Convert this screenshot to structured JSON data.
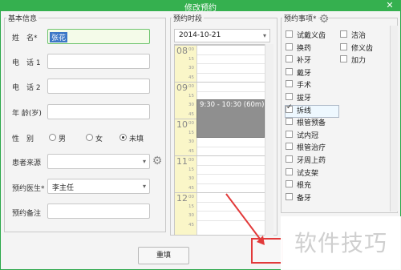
{
  "window": {
    "title": "修改预约",
    "close_label": "✕"
  },
  "basic_info": {
    "legend": "基本信息",
    "name_label": "姓　名*",
    "name_value": "张花",
    "phone1_label": "电　话 1",
    "phone2_label": "电　话 2",
    "age_label": "年 龄(岁)",
    "gender_label": "性　别",
    "gender_options": [
      "男",
      "女",
      "未填"
    ],
    "gender_selected": "未填",
    "source_label": "患者来源",
    "source_value": "",
    "doctor_label": "预约医生*",
    "doctor_value": "李主任",
    "note_label": "预约备注"
  },
  "time_slot": {
    "legend": "预约时段",
    "date_value": "2014-10-21",
    "hours": [
      "08",
      "09",
      "10",
      "11",
      "12"
    ],
    "minute_labels": [
      "00",
      "15",
      "30",
      "45"
    ],
    "appointment_label": "9:30 - 10:30 (60m)"
  },
  "items": {
    "legend": "预约事项*",
    "col1": [
      {
        "label": "试戴义齿",
        "checked": false
      },
      {
        "label": "换药",
        "checked": false
      },
      {
        "label": "补牙",
        "checked": false
      },
      {
        "label": "戴牙",
        "checked": false
      },
      {
        "label": "手术",
        "checked": false
      },
      {
        "label": "拔牙",
        "checked": false
      },
      {
        "label": "拆线",
        "checked": true
      },
      {
        "label": "根管预备",
        "checked": false
      },
      {
        "label": "试内冠",
        "checked": false
      },
      {
        "label": "根管治疗",
        "checked": false
      },
      {
        "label": "牙周上药",
        "checked": false
      },
      {
        "label": "试支架",
        "checked": false
      },
      {
        "label": "根充",
        "checked": false
      },
      {
        "label": "备牙",
        "checked": false
      }
    ],
    "col2": [
      {
        "label": "洁治",
        "checked": false
      },
      {
        "label": "修义齿",
        "checked": false
      },
      {
        "label": "加力",
        "checked": false
      }
    ]
  },
  "buttons": {
    "reset_label": "重填",
    "ok_label": ""
  },
  "watermark": "软件技巧",
  "colors": {
    "titlebar": "#35b04f",
    "appointment": "#8f8f8f",
    "hour_column": "#faf6c8",
    "annotation": "#e23a3a"
  }
}
